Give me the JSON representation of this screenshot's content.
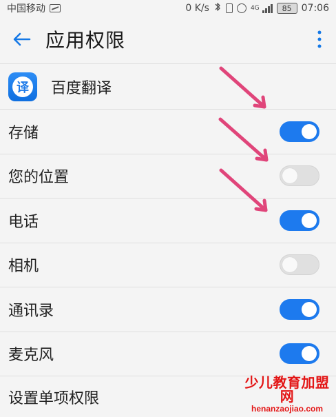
{
  "status_bar": {
    "carrier": "中国移动",
    "speed": "0 K/s",
    "network": "4G",
    "battery": "85",
    "time": "07:06",
    "icons": [
      "activity-icon",
      "bluetooth-icon",
      "vibrate-icon",
      "alarm-icon",
      "signal-icon",
      "battery-icon"
    ]
  },
  "header": {
    "title": "应用权限",
    "back_icon": "back-arrow-icon",
    "more_icon": "more-vertical-icon"
  },
  "app": {
    "name": "百度翻译",
    "icon_text": "译"
  },
  "permissions": [
    {
      "label": "存储",
      "enabled": true
    },
    {
      "label": "您的位置",
      "enabled": false
    },
    {
      "label": "电话",
      "enabled": true
    },
    {
      "label": "相机",
      "enabled": false
    },
    {
      "label": "通讯录",
      "enabled": true
    },
    {
      "label": "麦克风",
      "enabled": true
    }
  ],
  "footer_setting": {
    "label": "设置单项权限"
  },
  "watermark": {
    "line1": "少儿教育加盟网",
    "line2": "henanzaojiao.com"
  },
  "colors": {
    "accent": "#1d7aee",
    "arrow": "#e0457a",
    "watermark": "#e31616"
  }
}
